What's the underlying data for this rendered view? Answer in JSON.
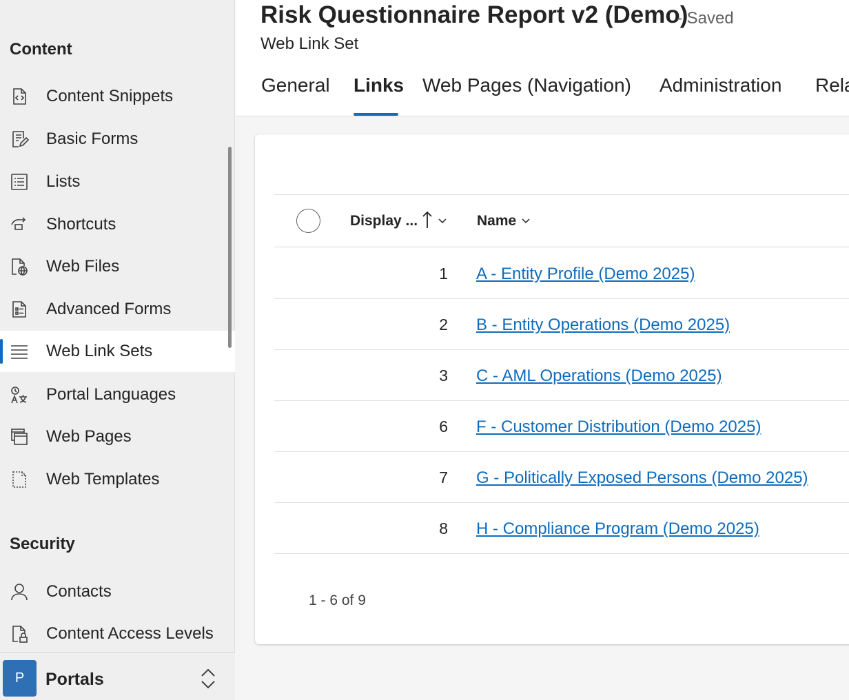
{
  "sidebar": {
    "content_heading": "Content",
    "content_items": [
      {
        "label": "Content Snippets",
        "icon": "content-snippets-icon"
      },
      {
        "label": "Basic Forms",
        "icon": "basic-forms-icon"
      },
      {
        "label": "Lists",
        "icon": "lists-icon"
      },
      {
        "label": "Shortcuts",
        "icon": "shortcuts-icon"
      },
      {
        "label": "Web Files",
        "icon": "web-files-icon"
      },
      {
        "label": "Advanced Forms",
        "icon": "advanced-forms-icon"
      },
      {
        "label": "Web Link Sets",
        "icon": "web-link-sets-icon",
        "selected": true
      },
      {
        "label": "Portal Languages",
        "icon": "portal-languages-icon"
      },
      {
        "label": "Web Pages",
        "icon": "web-pages-icon"
      },
      {
        "label": "Web Templates",
        "icon": "web-templates-icon"
      }
    ],
    "security_heading": "Security",
    "security_items": [
      {
        "label": "Contacts",
        "icon": "contacts-icon"
      },
      {
        "label": "Content Access Levels",
        "icon": "content-access-levels-icon"
      }
    ],
    "area": {
      "avatar_letter": "P",
      "label": "Portals",
      "avatar_color": "#2f6fb5"
    }
  },
  "record": {
    "title": "Risk Questionnaire Report v2 (Demo)",
    "save_status": "- Saved",
    "entity": "Web Link Set"
  },
  "tabs": [
    {
      "label": "General",
      "active": false
    },
    {
      "label": "Links",
      "active": true
    },
    {
      "label": "Web Pages (Navigation)",
      "active": false
    },
    {
      "label": "Administration",
      "active": false
    },
    {
      "label": "Rela",
      "active": false
    }
  ],
  "grid": {
    "columns": {
      "display_order": "Display ...",
      "name": "Name"
    },
    "sort": {
      "column": "display_order",
      "direction": "ascending"
    },
    "rows": [
      {
        "order": "1",
        "name": "A - Entity Profile (Demo 2025)"
      },
      {
        "order": "2",
        "name": "B - Entity Operations (Demo 2025)"
      },
      {
        "order": "3",
        "name": "C - AML Operations (Demo 2025)"
      },
      {
        "order": "6",
        "name": "F - Customer Distribution (Demo 2025)"
      },
      {
        "order": "7",
        "name": "G - Politically Exposed Persons (Demo 2025)"
      },
      {
        "order": "8",
        "name": "H - Compliance Program (Demo 2025)"
      }
    ],
    "pager": "1 - 6 of 9"
  },
  "colors": {
    "accent": "#0f6cbd",
    "link": "#0f6cbd",
    "selected_bg": "#ffffff"
  }
}
